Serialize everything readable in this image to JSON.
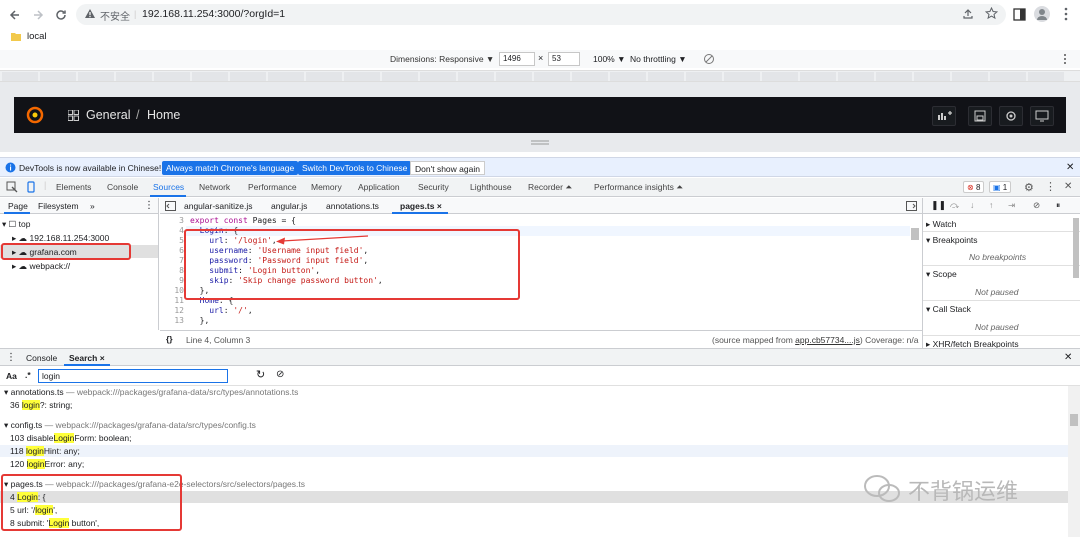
{
  "browser": {
    "security_label": "不安全",
    "url": "192.168.11.254:3000/?orgId=1",
    "bookmark_folder": "local"
  },
  "device_toolbar": {
    "dimensions_label": "Dimensions: Responsive ▼",
    "width": "1496",
    "times": "×",
    "height": "53",
    "zoom": "100% ▼",
    "throttle": "No throttling ▼"
  },
  "grafana": {
    "breadcrumb_folder": "General",
    "separator": "/",
    "breadcrumb_page": "Home"
  },
  "infobar": {
    "message": "DevTools is now available in Chinese!",
    "btn_match": "Always match Chrome's language",
    "btn_switch": "Switch DevTools to Chinese",
    "btn_dont_show": "Don't show again"
  },
  "devtools_tabs": [
    "Elements",
    "Console",
    "Sources",
    "Network",
    "Performance",
    "Memory",
    "Application",
    "Security",
    "Lighthouse",
    "Recorder ⏶",
    "Performance insights ⏶"
  ],
  "devtools_badges": {
    "errors": "8",
    "messages": "1"
  },
  "navigator": {
    "tabs": [
      "Page",
      "Filesystem",
      "»"
    ],
    "items": [
      "top",
      "192.168.11.254:3000",
      "grafana.com",
      "webpack://"
    ]
  },
  "editor": {
    "tabs": [
      "angular-sanitize.js",
      "angular.js",
      "annotations.ts",
      "pages.ts ×"
    ],
    "lines": [
      {
        "n": "3",
        "text": "export const Pages = {"
      },
      {
        "n": "4",
        "text": "  Login: {"
      },
      {
        "n": "5",
        "text": "    url: '/login',"
      },
      {
        "n": "6",
        "text": "    username: 'Username input field',"
      },
      {
        "n": "7",
        "text": "    password: 'Password input field',"
      },
      {
        "n": "8",
        "text": "    submit: 'Login button',"
      },
      {
        "n": "9",
        "text": "    skip: 'Skip change password button',"
      },
      {
        "n": "10",
        "text": "  },"
      },
      {
        "n": "11",
        "text": "  Home: {"
      },
      {
        "n": "12",
        "text": "    url: '/',"
      },
      {
        "n": "13",
        "text": "  },"
      }
    ],
    "status_position": "Line 4, Column 3",
    "status_source_prefix": "(source mapped from ",
    "status_source_link": "app.cb57734....js",
    "status_source_suffix": ") Coverage: n/a",
    "braces": "{}"
  },
  "sidepane": {
    "watch": "Watch",
    "breakpoints": "Breakpoints",
    "no_breakpoints": "No breakpoints",
    "scope": "Scope",
    "scope_state": "Not paused",
    "callstack": "Call Stack",
    "callstack_state": "Not paused",
    "xhr": "XHR/fetch Breakpoints"
  },
  "drawer": {
    "tabs": [
      "Console",
      "Search ×"
    ],
    "aa": "Aa",
    "regex": ".*",
    "query": "login"
  },
  "results": [
    {
      "file": "annotations.ts",
      "path": "— webpack:///packages/grafana-data/src/types/annotations.ts",
      "lines": [
        {
          "n": "36",
          "pre": "",
          "match": "login",
          "post": "?: string;"
        }
      ]
    },
    {
      "file": "config.ts",
      "path": "— webpack:///packages/grafana-data/src/types/config.ts",
      "lines": [
        {
          "n": "103",
          "pre": "disable",
          "match": "Login",
          "post": "Form: boolean;"
        },
        {
          "n": "118",
          "pre": "",
          "match": "login",
          "post": "Hint: any;"
        },
        {
          "n": "120",
          "pre": "",
          "match": "login",
          "post": "Error: any;"
        }
      ]
    },
    {
      "file": "pages.ts",
      "path": "— webpack:///packages/grafana-e2e-selectors/src/selectors/pages.ts",
      "lines": [
        {
          "n": "4",
          "pre": "",
          "match": "Login",
          "post": ": {"
        },
        {
          "n": "5",
          "pre": "url: '/",
          "match": "login",
          "post": "',"
        },
        {
          "n": "8",
          "pre": "submit: '",
          "match": "Login",
          "post": " button',"
        }
      ]
    }
  ],
  "watermark": "不背锅运维",
  "colors": {
    "accent": "#1a73e8",
    "highlight": "#ffff3a",
    "annotation_red": "#e53935",
    "grafana_bg": "#111217"
  }
}
